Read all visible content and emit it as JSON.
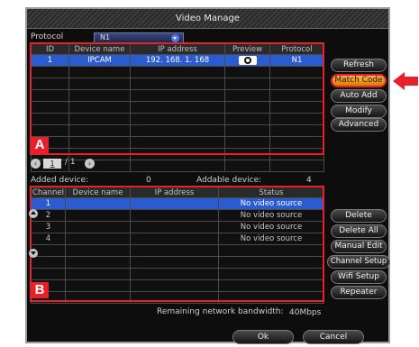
{
  "window": {
    "title": "Video Manage"
  },
  "protocol": {
    "label": "Protocol",
    "value": "N1"
  },
  "top_table": {
    "headers": [
      "ID",
      "Device name",
      "IP address",
      "Preview",
      "Protocol"
    ],
    "rows": [
      {
        "id": "1",
        "device_name": "IPCAM",
        "ip": "192. 168. 1. 168",
        "preview": "eye-icon",
        "protocol": "N1"
      }
    ]
  },
  "pager": {
    "current": "1",
    "total_text": "/ 1"
  },
  "right_buttons": {
    "refresh": "Refresh",
    "match_code": "Match Code",
    "auto_add": "Auto Add",
    "modify": "Modify",
    "advanced": "Advanced",
    "delete": "Delete",
    "delete_all": "Delete All",
    "manual_edit": "Manual Edit",
    "channel_setup": "Channel Setup",
    "wifi_setup": "Wifi Setup",
    "repeater": "Repeater"
  },
  "counts": {
    "added_label": "Added device:",
    "added_value": "0",
    "addable_label": "Addable device:",
    "addable_value": "4"
  },
  "bottom_table": {
    "headers": [
      "Channel",
      "Device name",
      "IP address",
      "Status"
    ],
    "rows": [
      {
        "channel": "1",
        "device_name": "",
        "ip": "",
        "status": "No video source"
      },
      {
        "channel": "2",
        "device_name": "",
        "ip": "",
        "status": "No video source"
      },
      {
        "channel": "3",
        "device_name": "",
        "ip": "",
        "status": "No video source"
      },
      {
        "channel": "4",
        "device_name": "",
        "ip": "",
        "status": "No video source"
      }
    ]
  },
  "bandwidth": {
    "label": "Remaining network bandwidth:",
    "value": "40Mbps"
  },
  "footer": {
    "ok": "Ok",
    "cancel": "Cancel"
  },
  "annotations": {
    "a": "A",
    "b": "B"
  },
  "colors": {
    "highlight": "#e8202a",
    "selection": "#2a5bd0",
    "match_code": "#f39a1c"
  }
}
